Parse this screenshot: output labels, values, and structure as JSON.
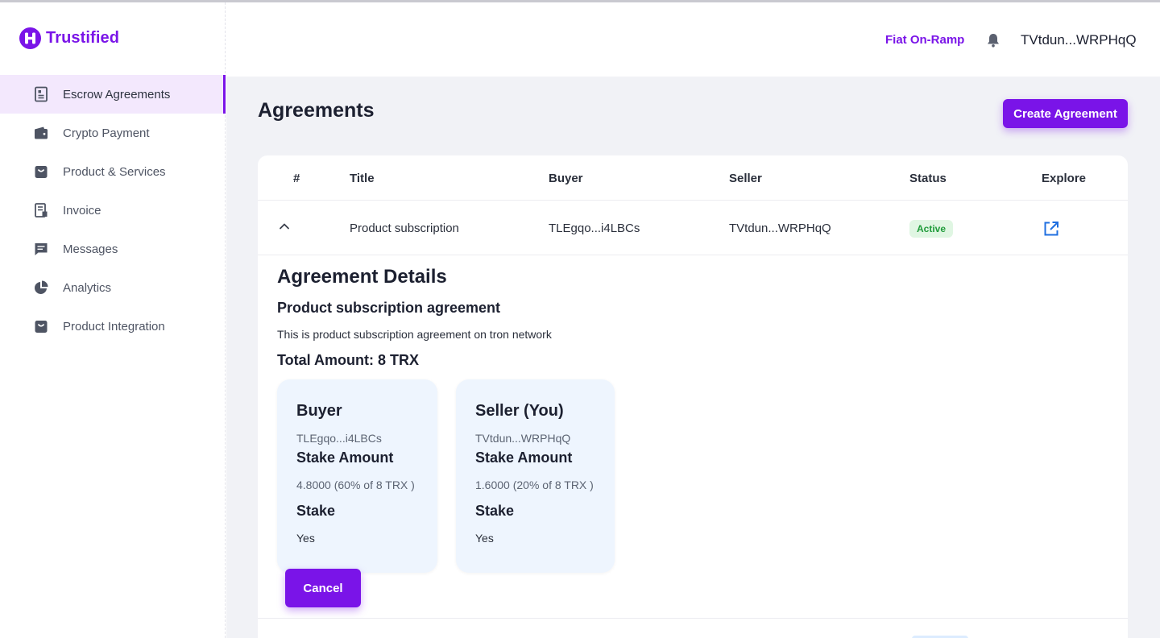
{
  "brand": {
    "name": "Trustified",
    "color": "#7a14e8"
  },
  "sidebar": {
    "items": [
      {
        "label": "Escrow Agreements",
        "icon": "document-icon",
        "active": true
      },
      {
        "label": "Crypto Payment",
        "icon": "wallet-icon",
        "active": false
      },
      {
        "label": "Product & Services",
        "icon": "bag-icon",
        "active": false
      },
      {
        "label": "Invoice",
        "icon": "invoice-icon",
        "active": false
      },
      {
        "label": "Messages",
        "icon": "message-icon",
        "active": false
      },
      {
        "label": "Analytics",
        "icon": "pie-chart-icon",
        "active": false
      },
      {
        "label": "Product Integration",
        "icon": "bag-icon",
        "active": false
      }
    ]
  },
  "header": {
    "fiat_label": "Fiat On-Ramp",
    "bell_icon": "bell-icon",
    "wallet_address": "TVtdun...WRPHqQ"
  },
  "page": {
    "title": "Agreements",
    "create_label": "Create Agreement"
  },
  "table": {
    "columns": [
      "#",
      "Title",
      "Buyer",
      "Seller",
      "Status",
      "Explore"
    ],
    "row": {
      "title": "Product subscription",
      "buyer": "TLEgqo...i4LBCs",
      "seller": "TVtdun...WRPHqQ",
      "status": "Active",
      "status_color": "#1f9b3a"
    }
  },
  "details": {
    "heading": "Agreement Details",
    "subtitle": "Product subscription agreement",
    "description": "This is product subscription agreement on tron network",
    "total": "Total Amount: 8 TRX",
    "buyer": {
      "role": "Buyer",
      "address": "TLEgqo...i4LBCs",
      "stake_amount_label": "Stake Amount",
      "stake_amount_value": "4.8000 (60% of 8 TRX )",
      "stake_label": "Stake",
      "stake_value": "Yes"
    },
    "seller": {
      "role": "Seller (You)",
      "address": "TVtdun...WRPHqQ",
      "stake_amount_label": "Stake Amount",
      "stake_amount_value": "1.6000 (20% of 8 TRX )",
      "stake_label": "Stake",
      "stake_value": "Yes"
    },
    "cancel_label": "Cancel"
  }
}
